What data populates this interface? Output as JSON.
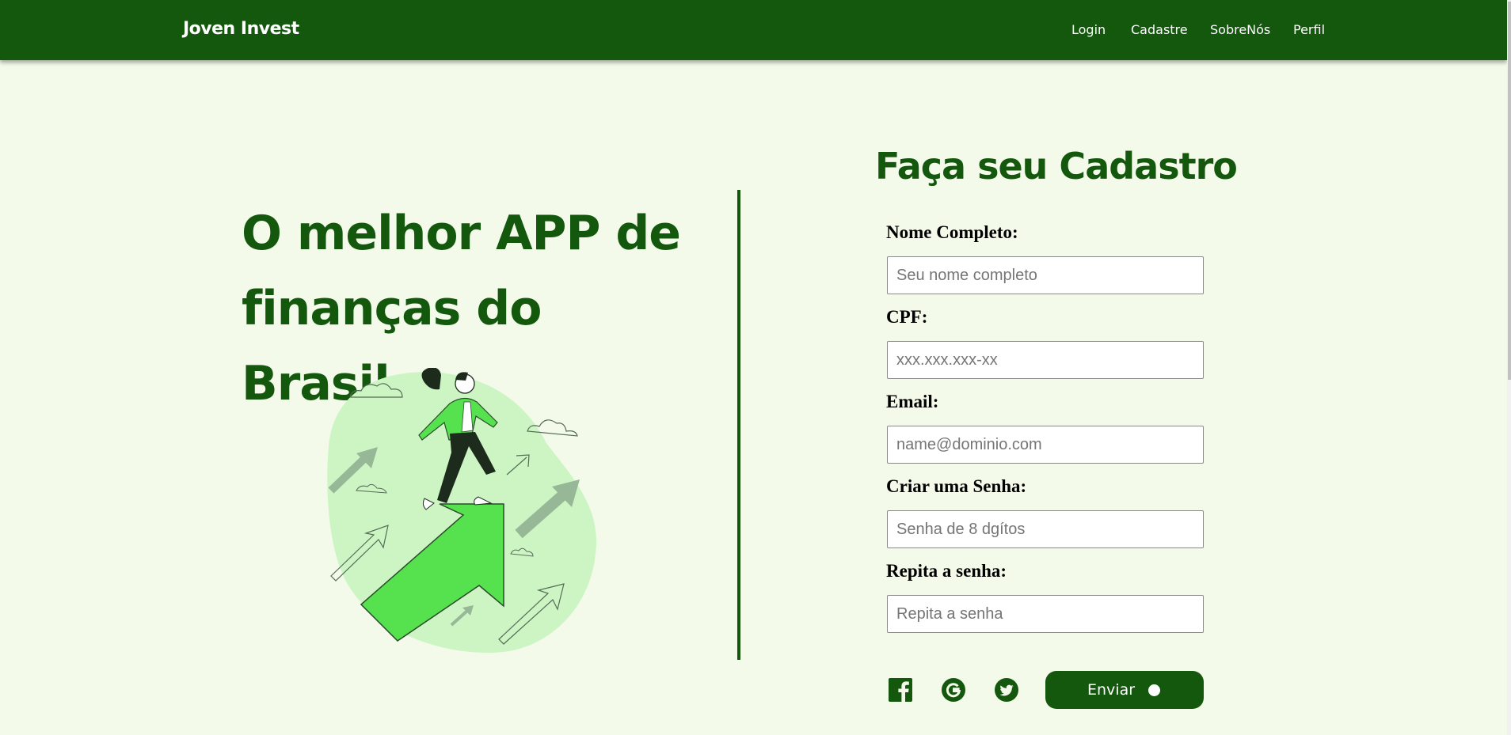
{
  "nav": {
    "brand": "Joven Invest",
    "links": [
      "Login",
      "Cadastre",
      "SobreNós",
      "Perfil"
    ]
  },
  "hero": {
    "title": "O melhor APP de\nfinanças do Brasil"
  },
  "form": {
    "title": "Faça seu Cadastro",
    "fields": [
      {
        "label": "Nome Completo:",
        "placeholder": "Seu nome completo",
        "value": ""
      },
      {
        "label": "CPF:",
        "placeholder": "xxx.xxx.xxx-xx",
        "value": ""
      },
      {
        "label": "Email:",
        "placeholder": "name@dominio.com",
        "value": ""
      },
      {
        "label": "Criar uma Senha:",
        "placeholder": "Senha de 8 dgítos",
        "value": ""
      },
      {
        "label": "Repita a senha:",
        "placeholder": "Repita a senha",
        "value": ""
      }
    ],
    "social": [
      "facebook-icon",
      "google-icon",
      "twitter-icon"
    ],
    "submit_label": "Enviar"
  },
  "colors": {
    "primary": "#14580e",
    "background": "#f3faea",
    "accent_green": "#56e24e",
    "blob_green": "#cdf5c4"
  }
}
